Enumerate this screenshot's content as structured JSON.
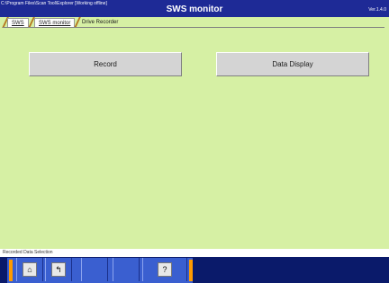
{
  "titlebar": {
    "path": "C:\\Program Files\\Scan Tool\\Explorer [Working offline]",
    "title": "SWS monitor",
    "version": "Ver.1.4.0"
  },
  "breadcrumb": {
    "items": [
      {
        "label": "SWS"
      },
      {
        "label": "SWS monitor"
      },
      {
        "label": "Drive Recorder"
      }
    ]
  },
  "main": {
    "record_label": "Record",
    "data_display_label": "Data Display"
  },
  "status": {
    "text": "Recorded Data Selection"
  },
  "toolbar": {
    "home_glyph": "⌂",
    "back_glyph": "↰",
    "help_glyph": "?"
  },
  "colors": {
    "background": "#d6f0a4",
    "titlebar": "#1e2a96",
    "toolbar": "#0a1a6a",
    "toolbar_buttons": "#3a5fd0",
    "toolbar_bracket": "#ff9a00",
    "button": "#d4d4d4"
  },
  "icons": [
    "home-icon",
    "back-icon",
    "help-icon"
  ]
}
